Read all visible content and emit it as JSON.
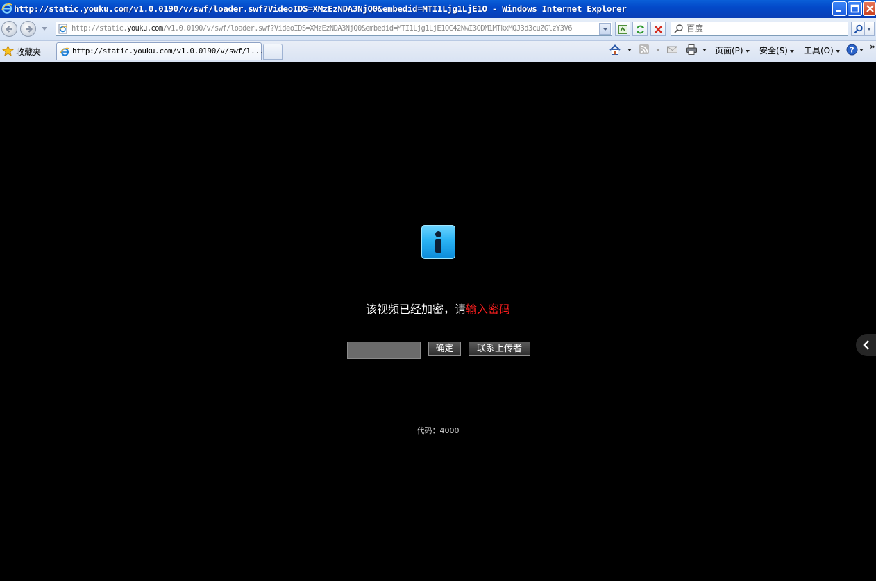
{
  "window": {
    "title": "http://static.youku.com/v1.0.0190/v/swf/loader.swf?VideoIDS=XMzEzNDA3NjQ0&embedid=MTI1Ljg1LjE1O - Windows Internet Explorer",
    "browser_icon": "ie-logo-icon",
    "controls": [
      "minimize-icon",
      "maximize-icon",
      "close-icon"
    ]
  },
  "address_bar": {
    "url_prefix": "http://static.",
    "url_domain": "youku.com",
    "url_rest": "/v1.0.0190/v/swf/loader.swf?VideoIDS=XMzEzNDA3NjQ0&embedid=MTI1Ljg1LjE1OC42NwI3ODM1MTkxMQJ3d3cuZGlzY3V6",
    "search_placeholder": "百度"
  },
  "command_bar": {
    "favorites_label": "收藏夹",
    "tab_title": "http://static.youku.com/v1.0.0190/v/swf/l...",
    "page_menu": "页面(P)",
    "safety_menu": "安全(S)",
    "tools_menu": "工具(O)",
    "more": "»"
  },
  "player": {
    "icon": "info-icon",
    "message_prefix": "该视频已经加密，请",
    "message_link": "输入密码",
    "password_value": "",
    "confirm_button": "确定",
    "contact_button": "联系上传者",
    "error_code": "代码：4000"
  },
  "colors": {
    "background": "#000000",
    "link_red": "#ff1f1f",
    "titlebar_blue": "#0349c9"
  }
}
